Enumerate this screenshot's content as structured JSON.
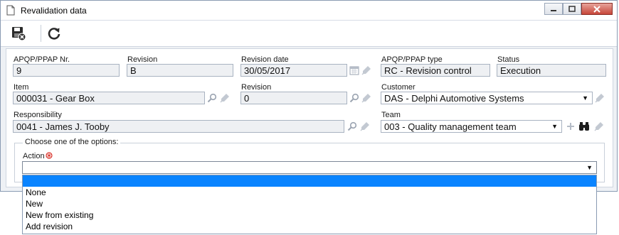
{
  "window": {
    "title": "Revalidation data"
  },
  "toolbar": {
    "save_label": "Save and exit",
    "refresh_label": "Refresh"
  },
  "form": {
    "apqp_nr": {
      "label": "APQP/PPAP Nr.",
      "value": "9"
    },
    "revision": {
      "label": "Revision",
      "value": "B"
    },
    "revision_date": {
      "label": "Revision date",
      "value": "30/05/2017"
    },
    "apqp_type": {
      "label": "APQP/PPAP type",
      "value": "RC - Revision control"
    },
    "status": {
      "label": "Status",
      "value": "Execution"
    },
    "item": {
      "label": "Item",
      "value": "000031 - Gear Box"
    },
    "item_revision": {
      "label": "Revision",
      "value": "0"
    },
    "customer": {
      "label": "Customer",
      "value": "DAS - Delphi Automotive Systems"
    },
    "responsibility": {
      "label": "Responsibility",
      "value": "0041 - James J. Tooby"
    },
    "team": {
      "label": "Team",
      "value": "003 - Quality management team"
    }
  },
  "options_group": {
    "legend": "Choose one of the options:",
    "action_label": "Action",
    "action_value": "",
    "required_color": "#d9342b",
    "items": [
      "None",
      "New",
      "New from existing",
      "Add revision"
    ],
    "highlight_color": "#0a84ff"
  }
}
